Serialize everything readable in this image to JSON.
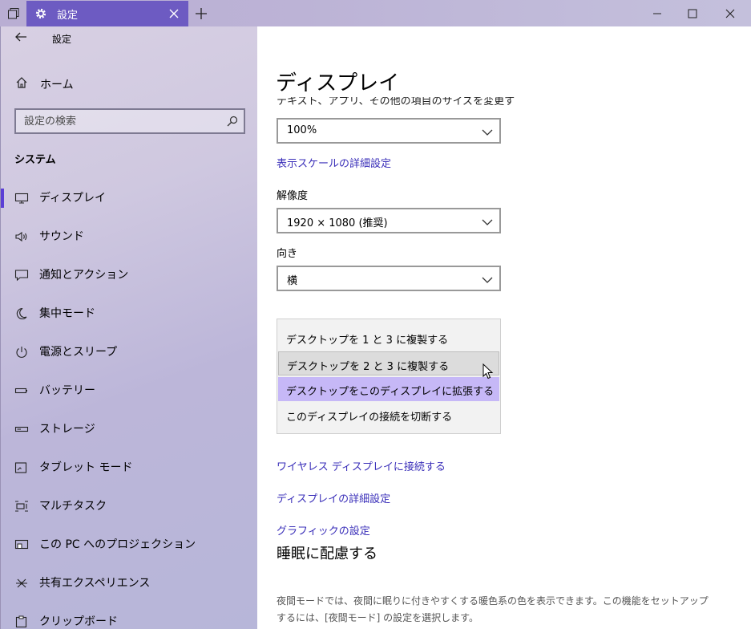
{
  "window": {
    "tab_title": "設定",
    "new_tab": "+"
  },
  "sidebar": {
    "app_title": "設定",
    "home": "ホーム",
    "search_placeholder": "設定の検索",
    "section_title": "システム",
    "items": [
      {
        "label": "ディスプレイ",
        "icon": "monitor-icon",
        "selected": true
      },
      {
        "label": "サウンド",
        "icon": "speaker-icon"
      },
      {
        "label": "通知とアクション",
        "icon": "notification-icon"
      },
      {
        "label": "集中モード",
        "icon": "moon-icon"
      },
      {
        "label": "電源とスリープ",
        "icon": "power-icon"
      },
      {
        "label": "バッテリー",
        "icon": "battery-icon"
      },
      {
        "label": "ストレージ",
        "icon": "storage-icon"
      },
      {
        "label": "タブレット モード",
        "icon": "tablet-icon"
      },
      {
        "label": "マルチタスク",
        "icon": "multitask-icon"
      },
      {
        "label": "この PC へのプロジェクション",
        "icon": "projection-icon"
      },
      {
        "label": "共有エクスペリエンス",
        "icon": "share-icon"
      },
      {
        "label": "クリップボード",
        "icon": "clipboard-icon"
      }
    ]
  },
  "main": {
    "page_title": "ディスプレイ",
    "scale_label_cut": "テキスト、アプリ、その他の項目のサイズを変更する",
    "scale_value": "100%",
    "scale_advanced_link": "表示スケールの詳細設定",
    "resolution_label": "解像度",
    "resolution_value": "1920 × 1080 (推奨)",
    "orientation_label": "向き",
    "orientation_value": "横",
    "multi_display_options": [
      "デスクトップを 1 と 3 に複製する",
      "デスクトップを 2 と 3 に複製する",
      "デスクトップをこのディスプレイに拡張する",
      "このディスプレイの接続を切断する"
    ],
    "wireless_link": "ワイヤレス ディスプレイに接続する",
    "advanced_display_link": "ディスプレイの詳細設定",
    "graphics_link": "グラフィックの設定",
    "sleep_heading": "睡眠に配慮する",
    "night_desc_1": "夜間モードでは、夜間に眠りに付きやすくする暖色系の色を表示できます。この機能をセットアップ",
    "night_desc_2": "するには、[夜間モード] の設定を選択します。"
  },
  "colors": {
    "accent": "#6d5bc2",
    "link": "#3a2fb9",
    "selected_option": "#c6b8f7"
  }
}
